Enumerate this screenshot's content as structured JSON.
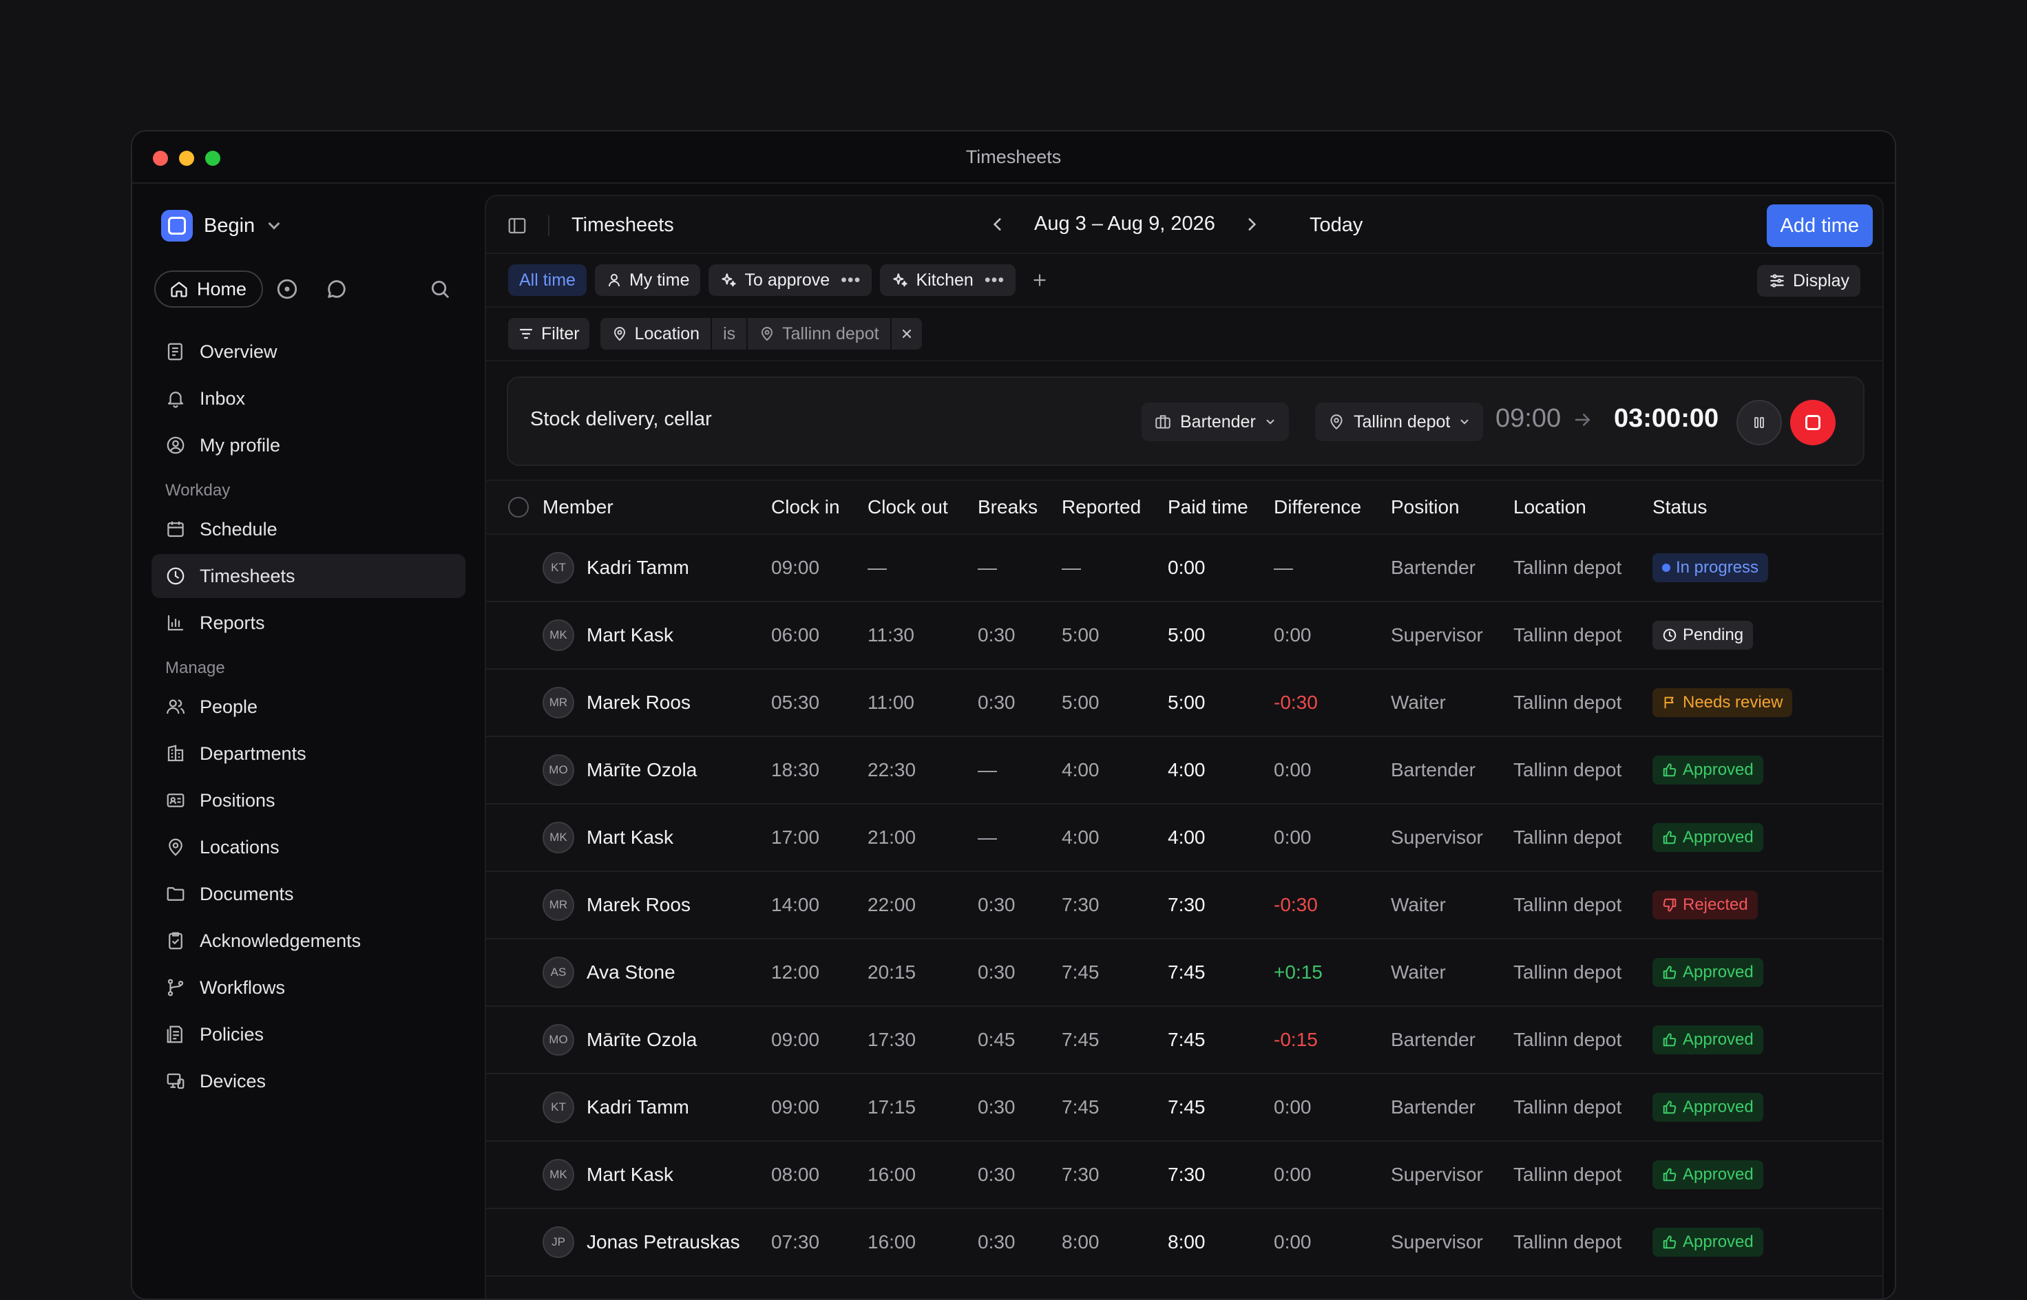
{
  "window": {
    "title": "Timesheets"
  },
  "workspace": {
    "name": "Begin"
  },
  "sidebar": {
    "home_label": "Home",
    "primary": [
      {
        "label": "Overview",
        "icon": "overview-icon"
      },
      {
        "label": "Inbox",
        "icon": "bell-icon"
      },
      {
        "label": "My profile",
        "icon": "user-circle-icon"
      }
    ],
    "workday_label": "Workday",
    "workday": [
      {
        "label": "Schedule",
        "icon": "calendar-icon"
      },
      {
        "label": "Timesheets",
        "icon": "clock-icon",
        "active": true
      },
      {
        "label": "Reports",
        "icon": "bar-chart-icon"
      }
    ],
    "manage_label": "Manage",
    "manage": [
      {
        "label": "People",
        "icon": "people-icon"
      },
      {
        "label": "Departments",
        "icon": "building-icon"
      },
      {
        "label": "Positions",
        "icon": "id-card-icon"
      },
      {
        "label": "Locations",
        "icon": "map-pin-icon"
      },
      {
        "label": "Documents",
        "icon": "folder-icon"
      },
      {
        "label": "Acknowledgements",
        "icon": "clipboard-check-icon"
      },
      {
        "label": "Workflows",
        "icon": "workflow-icon"
      },
      {
        "label": "Policies",
        "icon": "policy-icon"
      },
      {
        "label": "Devices",
        "icon": "devices-icon"
      }
    ]
  },
  "toolbar": {
    "title": "Timesheets",
    "date_range": "Aug 3 – Aug 9, 2026",
    "today_label": "Today",
    "add_label": "Add time"
  },
  "views": {
    "all": "All time",
    "mine": "My time",
    "approve": "To approve",
    "kitchen": "Kitchen",
    "display_label": "Display"
  },
  "filter": {
    "label": "Filter",
    "field": "Location",
    "operator": "is",
    "value": "Tallinn depot"
  },
  "timer": {
    "description": "Stock delivery, cellar",
    "position": "Bartender",
    "location": "Tallinn depot",
    "start": "09:00",
    "elapsed": "03:00:00"
  },
  "table": {
    "headers": {
      "member": "Member",
      "clock_in": "Clock in",
      "clock_out": "Clock out",
      "breaks": "Breaks",
      "reported": "Reported",
      "paid": "Paid time",
      "difference": "Difference",
      "position": "Position",
      "location": "Location",
      "status": "Status"
    },
    "rows": [
      {
        "initials": "KT",
        "member": "Kadri Tamm",
        "in": "09:00",
        "out": "—",
        "breaks": "—",
        "reported": "—",
        "paid": "0:00",
        "diff": "—",
        "diff_type": "none",
        "position": "Bartender",
        "location": "Tallinn depot",
        "status": "In progress",
        "status_type": "progress"
      },
      {
        "initials": "MK",
        "member": "Mart Kask",
        "in": "06:00",
        "out": "11:30",
        "breaks": "0:30",
        "reported": "5:00",
        "paid": "5:00",
        "diff": "0:00",
        "diff_type": "none",
        "position": "Supervisor",
        "location": "Tallinn depot",
        "status": "Pending",
        "status_type": "pending"
      },
      {
        "initials": "MR",
        "member": "Marek Roos",
        "in": "05:30",
        "out": "11:00",
        "breaks": "0:30",
        "reported": "5:00",
        "paid": "5:00",
        "diff": "-0:30",
        "diff_type": "neg",
        "position": "Waiter",
        "location": "Tallinn depot",
        "status": "Needs review",
        "status_type": "review"
      },
      {
        "initials": "MO",
        "member": "Mārīte Ozola",
        "in": "18:30",
        "out": "22:30",
        "breaks": "—",
        "reported": "4:00",
        "paid": "4:00",
        "diff": "0:00",
        "diff_type": "none",
        "position": "Bartender",
        "location": "Tallinn depot",
        "status": "Approved",
        "status_type": "approved"
      },
      {
        "initials": "MK",
        "member": "Mart Kask",
        "in": "17:00",
        "out": "21:00",
        "breaks": "—",
        "reported": "4:00",
        "paid": "4:00",
        "diff": "0:00",
        "diff_type": "none",
        "position": "Supervisor",
        "location": "Tallinn depot",
        "status": "Approved",
        "status_type": "approved"
      },
      {
        "initials": "MR",
        "member": "Marek Roos",
        "in": "14:00",
        "out": "22:00",
        "breaks": "0:30",
        "reported": "7:30",
        "paid": "7:30",
        "diff": "-0:30",
        "diff_type": "neg",
        "position": "Waiter",
        "location": "Tallinn depot",
        "status": "Rejected",
        "status_type": "rejected"
      },
      {
        "initials": "AS",
        "member": "Ava Stone",
        "in": "12:00",
        "out": "20:15",
        "breaks": "0:30",
        "reported": "7:45",
        "paid": "7:45",
        "diff": "+0:15",
        "diff_type": "pos",
        "position": "Waiter",
        "location": "Tallinn depot",
        "status": "Approved",
        "status_type": "approved"
      },
      {
        "initials": "MO",
        "member": "Mārīte Ozola",
        "in": "09:00",
        "out": "17:30",
        "breaks": "0:45",
        "reported": "7:45",
        "paid": "7:45",
        "diff": "-0:15",
        "diff_type": "neg",
        "position": "Bartender",
        "location": "Tallinn depot",
        "status": "Approved",
        "status_type": "approved"
      },
      {
        "initials": "KT",
        "member": "Kadri Tamm",
        "in": "09:00",
        "out": "17:15",
        "breaks": "0:30",
        "reported": "7:45",
        "paid": "7:45",
        "diff": "0:00",
        "diff_type": "none",
        "position": "Bartender",
        "location": "Tallinn depot",
        "status": "Approved",
        "status_type": "approved"
      },
      {
        "initials": "MK",
        "member": "Mart Kask",
        "in": "08:00",
        "out": "16:00",
        "breaks": "0:30",
        "reported": "7:30",
        "paid": "7:30",
        "diff": "0:00",
        "diff_type": "none",
        "position": "Supervisor",
        "location": "Tallinn depot",
        "status": "Approved",
        "status_type": "approved"
      },
      {
        "initials": "JP",
        "member": "Jonas Petrauskas",
        "in": "07:30",
        "out": "16:00",
        "breaks": "0:30",
        "reported": "8:00",
        "paid": "8:00",
        "diff": "0:00",
        "diff_type": "none",
        "position": "Supervisor",
        "location": "Tallinn depot",
        "status": "Approved",
        "status_type": "approved"
      }
    ]
  }
}
